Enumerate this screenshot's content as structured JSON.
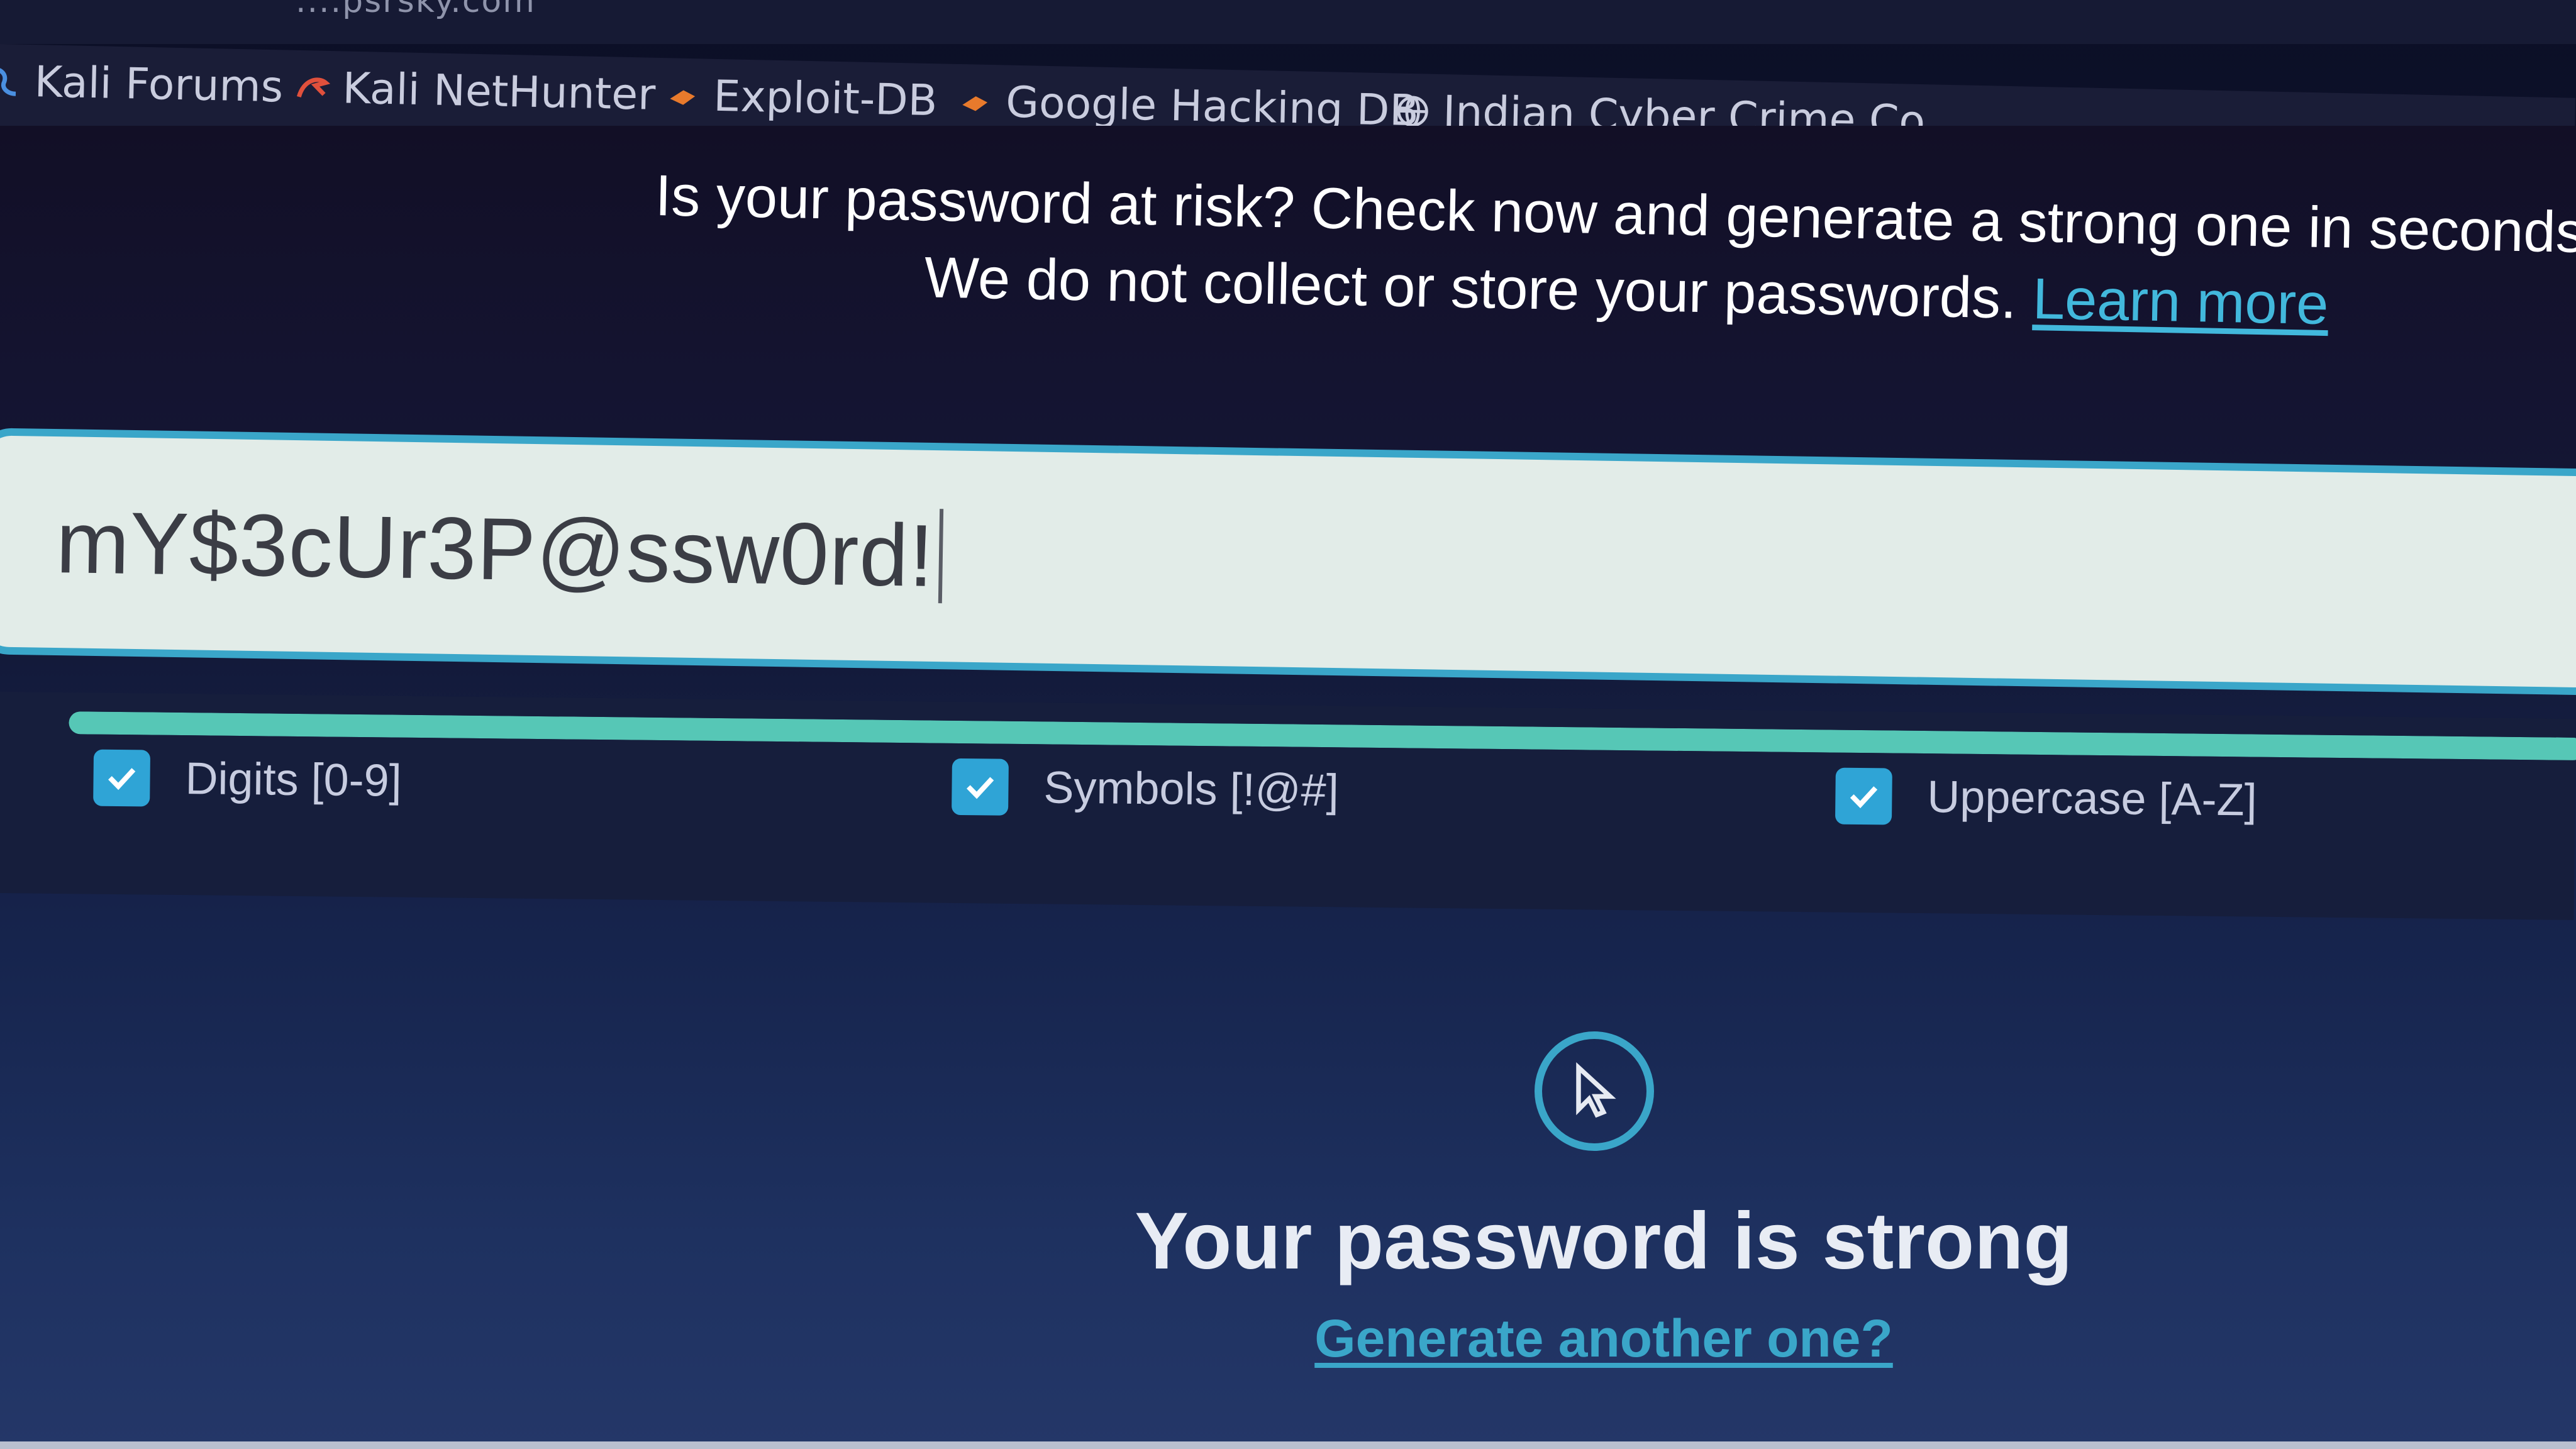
{
  "browser": {
    "tab_title_partial": "....psrsky.com",
    "bookmarks": [
      {
        "label": "Kali Forums",
        "icon": "kali-dragon-icon"
      },
      {
        "label": "Kali NetHunter",
        "icon": "nethunter-icon"
      },
      {
        "label": "Exploit-DB",
        "icon": "exploit-db-icon"
      },
      {
        "label": "Google Hacking DB",
        "icon": "ghdb-icon"
      },
      {
        "label": "Indian Cyber Crime Co...",
        "icon": "globe-icon"
      }
    ]
  },
  "intro": {
    "line1": "Is your password at risk? Check now and generate a strong one in seconds.",
    "line2": "We do not collect or store your passwords.",
    "learn_more": "Learn more"
  },
  "password": {
    "value": "mY$3cUr3P@ssw0rd!"
  },
  "strength": {
    "level": 1.0,
    "criteria": [
      {
        "label": "Digits [0-9]",
        "checked": true
      },
      {
        "label": "Symbols [!@#]",
        "checked": true
      },
      {
        "label": "Uppercase [A-Z]",
        "checked": true
      }
    ]
  },
  "result": {
    "title": "Your password is strong",
    "generate_link": "Generate another one?"
  },
  "colors": {
    "accent": "#3aa6c9",
    "strength_bar": "#56c7b6",
    "field_bg": "#e2ece8"
  }
}
